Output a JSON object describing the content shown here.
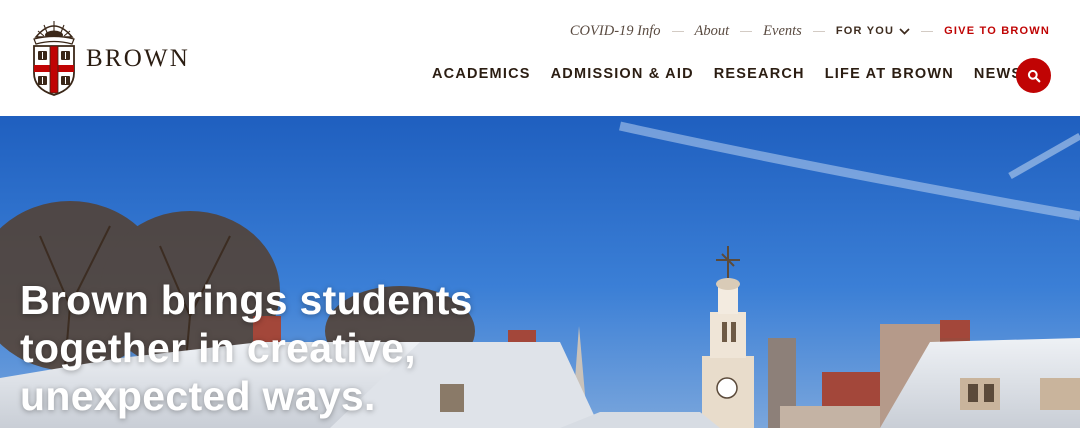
{
  "brand": {
    "name": "BROWN",
    "logo_icon": "brown-coat-of-arms-icon"
  },
  "utility_nav": {
    "items": [
      {
        "label": "COVID-19 Info"
      },
      {
        "label": "About"
      },
      {
        "label": "Events"
      }
    ],
    "for_you": {
      "label": "FOR YOU",
      "icon": "chevron-down-icon"
    },
    "give": {
      "label": "GIVE TO BROWN",
      "color": "#c00404"
    }
  },
  "main_nav": {
    "items": [
      {
        "label": "ACADEMICS"
      },
      {
        "label": "ADMISSION & AID"
      },
      {
        "label": "RESEARCH"
      },
      {
        "label": "LIFE AT BROWN"
      },
      {
        "label": "NEWS"
      }
    ]
  },
  "search": {
    "icon": "search-icon",
    "color": "#c00404"
  },
  "hero": {
    "title": "Brown brings students together in creative, unexpected ways.",
    "image": "snowy-campus-rooftops-with-clock-tower"
  }
}
